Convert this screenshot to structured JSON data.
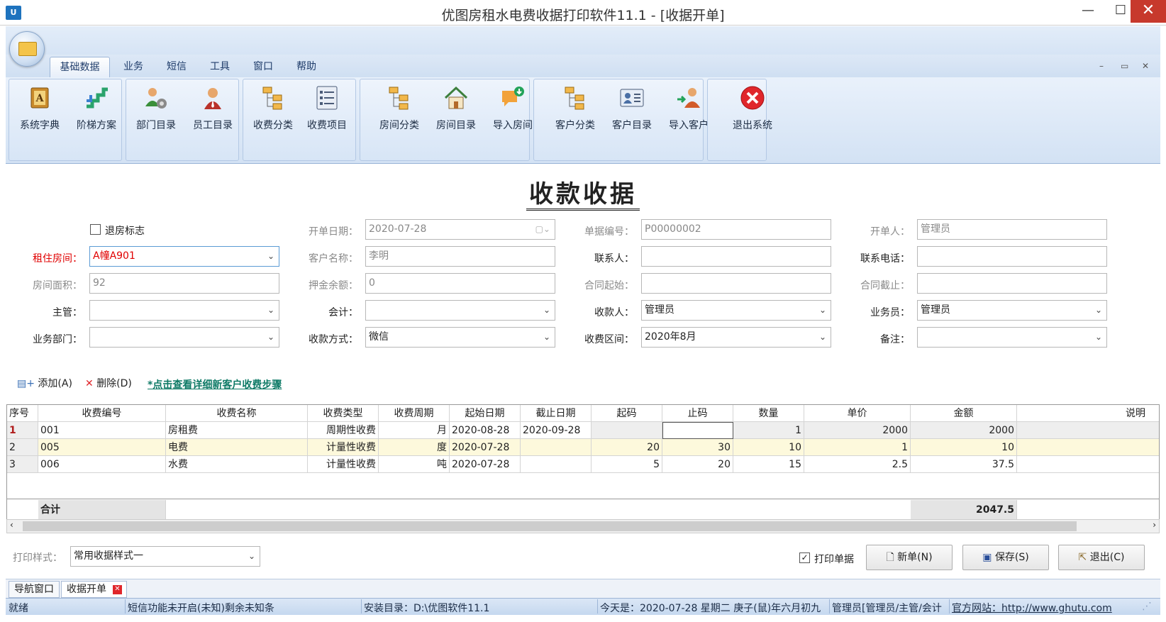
{
  "window": {
    "title": "优图房租水电费收据打印软件11.1 - [收据开单]",
    "app_icon": "U",
    "controls": {
      "minimize": "—",
      "maximize": "☐",
      "close": "✕"
    }
  },
  "ribbon": {
    "tabs": [
      "基础数据",
      "业务",
      "短信",
      "工具",
      "窗口",
      "帮助"
    ],
    "active_tab": "基础数据",
    "buttons": [
      {
        "label": "系统字典",
        "icon": "dictionary-icon"
      },
      {
        "label": "阶梯方案",
        "icon": "ladder-icon"
      },
      {
        "label": "部门目录",
        "icon": "department-icon"
      },
      {
        "label": "员工目录",
        "icon": "employee-icon"
      },
      {
        "label": "收费分类",
        "icon": "fee-category-icon"
      },
      {
        "label": "收费项目",
        "icon": "fee-item-icon"
      },
      {
        "label": "房间分类",
        "icon": "room-category-icon"
      },
      {
        "label": "房间目录",
        "icon": "room-list-icon"
      },
      {
        "label": "导入房间",
        "icon": "import-room-icon"
      },
      {
        "label": "客户分类",
        "icon": "customer-category-icon"
      },
      {
        "label": "客户目录",
        "icon": "customer-list-icon"
      },
      {
        "label": "导入客户",
        "icon": "import-customer-icon"
      },
      {
        "label": "退出系统",
        "icon": "exit-icon"
      }
    ]
  },
  "form": {
    "title": "收款收据",
    "checkout_flag_label": "退房标志",
    "labels": {
      "room": "租住房间：",
      "area": "房间面积：",
      "supervisor": "主管：",
      "dept": "业务部门：",
      "date": "开单日期：",
      "customer": "客户名称：",
      "deposit": "押金余额：",
      "accountant": "会计：",
      "paymethod": "收款方式：",
      "billno": "单据编号：",
      "contact": "联系人：",
      "contract_start": "合同起始：",
      "receiver": "收款人：",
      "period": "收费区间：",
      "issuer": "开单人：",
      "phone": "联系电话：",
      "contract_end": "合同截止：",
      "salesman": "业务员：",
      "remark": "备注："
    },
    "values": {
      "room": "A幢A901",
      "area": "92",
      "supervisor": "",
      "dept": "",
      "date": "2020-07-28",
      "customer": "李明",
      "deposit": "0",
      "accountant": "",
      "paymethod": "微信",
      "billno": "P00000002",
      "contact": "",
      "contract_start": "",
      "receiver": "管理员",
      "period": "2020年8月",
      "issuer": "管理员",
      "phone": "",
      "contract_end": "",
      "salesman": "管理员",
      "remark": ""
    }
  },
  "toolbar": {
    "add": "添加(A)",
    "delete": "删除(D)",
    "detail_link": "*点击查看详细新客户收费步骤"
  },
  "grid": {
    "columns": [
      "序号",
      "收费编号",
      "收费名称",
      "收费类型",
      "收费周期",
      "起始日期",
      "截止日期",
      "起码",
      "止码",
      "数量",
      "单价",
      "金额",
      "说明"
    ],
    "rows": [
      [
        "1",
        "001",
        "房租费",
        "周期性收费",
        "月",
        "2020-08-28",
        "2020-09-28",
        "",
        "",
        "1",
        "2000",
        "2000",
        ""
      ],
      [
        "2",
        "005",
        "电费",
        "计量性收费",
        "度",
        "2020-07-28",
        "",
        "20",
        "30",
        "10",
        "1",
        "10",
        ""
      ],
      [
        "3",
        "006",
        "水费",
        "计量性收费",
        "吨",
        "2020-07-28",
        "",
        "5",
        "20",
        "15",
        "2.5",
        "37.5",
        ""
      ]
    ],
    "total_label": "合计",
    "total_value": "2047.5"
  },
  "bottom": {
    "print_style_label": "打印样式：",
    "print_style_value": "常用收据样式一",
    "print_checkbox_label": "打印单据",
    "new_btn": "新单(N)",
    "save_btn": "保存(S)",
    "exit_btn": "退出(C)"
  },
  "mdi_tabs": [
    "导航窗口",
    "收据开单"
  ],
  "status": {
    "ready": "就绪",
    "sms": "短信功能未开启(未知)剩余未知条",
    "install": "安装目录：D:\\优图软件11.1",
    "today": "今天是：2020-07-28 星期二 庚子(鼠)年六月初九",
    "user": "管理员[管理员/主管/会计",
    "website": "官方网站：http://www.ghutu.com"
  },
  "colors": {
    "accent": "#1e73be",
    "ribbon": "#d6e4f5",
    "required": "#e00000",
    "link": "#0e7a66",
    "close": "#c7392c"
  }
}
